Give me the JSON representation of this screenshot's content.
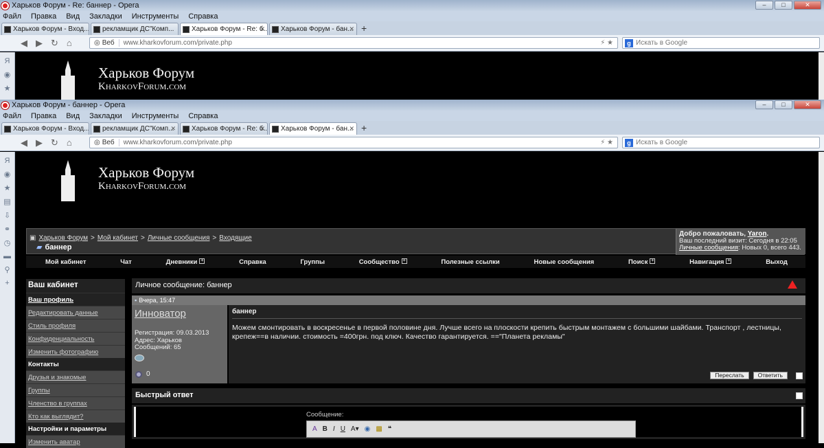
{
  "window1": {
    "title": "Харьков Форум - Re: баннер - Opera",
    "menu": [
      "Файл",
      "Правка",
      "Вид",
      "Закладки",
      "Инструменты",
      "Справка"
    ],
    "tabs": [
      "Харьков Форум - Вход...",
      "рекламщик ДС\"Комп...",
      "Харьков Форум - Re: б...",
      "Харьков Форум - бан..."
    ],
    "web_label": "Веб",
    "url": "www.kharkovforum.com/private.php",
    "search_placeholder": "Искать в Google"
  },
  "window2": {
    "title": "Харьков Форум - баннер - Opera",
    "menu": [
      "Файл",
      "Правка",
      "Вид",
      "Закладки",
      "Инструменты",
      "Справка"
    ],
    "tabs": [
      "Харьков Форум - Вход...",
      "рекламщик ДС\"Комп...",
      "Харьков Форум - Re: б...",
      "Харьков Форум - бан..."
    ],
    "web_label": "Веб",
    "url": "www.kharkovforum.com/private.php",
    "search_placeholder": "Искать в Google"
  },
  "logo": {
    "title": "Харьков Форум",
    "subtitle": "KharkovForum.com"
  },
  "breadcrumb": {
    "items": [
      "Харьков Форум",
      "Мой кабинет",
      "Личные сообщения",
      "Входящие"
    ],
    "separator": ">",
    "current": "баннер"
  },
  "welcome": {
    "greeting": "Добро пожаловать,",
    "user": "Yaron",
    "last_visit": "Ваш последний визит: Сегодня в 22:05",
    "pm_link": "Личные сообщения",
    "pm_counts": ": Новых 0, всего 443."
  },
  "nav": [
    "Мой кабинет",
    "Чат",
    "Дневники",
    "Справка",
    "Группы",
    "Сообщество",
    "Полезные ссылки",
    "Новые сообщения",
    "Поиск",
    "Навигация",
    "Выход"
  ],
  "sidebar": {
    "header": "Ваш кабинет",
    "items": [
      "Ваш профиль",
      "Редактировать данные",
      "Стиль профиля",
      "Конфиденциальность",
      "Изменить фотографию"
    ],
    "section2": "Контакты",
    "items2": [
      "Друзья и знакомые",
      "Группы",
      "Членство в группах",
      "Кто как выглядит?"
    ],
    "section3": "Настройки и параметры",
    "items3": [
      "Изменить аватар"
    ]
  },
  "pm": {
    "header_label": "Личное сообщение",
    "header_title": ": баннер",
    "date": "Вчера, 15:47",
    "author": "Инноватор",
    "reg": "Регистрация: 09.03.2013",
    "addr": "Адрес: Харьков",
    "posts": "Сообщений: 65",
    "subject": "баннер",
    "body": "Можем смонтировать в воскресенье в первой половине дня. Лучше всего на плоскости крепить быстрым монтажем с большими шайбами. Транспорт , лестницы, крепеж==в наличии. стоимость =400грн. под ключ. Качество гарантируется. ==\"Планета рекламы\"",
    "forward": "Переслать",
    "reply": "Ответить"
  },
  "quick_reply": {
    "title": "Быстрый ответ",
    "label": "Сообщение:"
  }
}
